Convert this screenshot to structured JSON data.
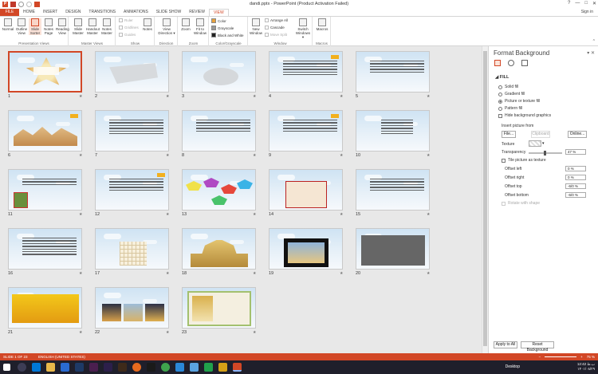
{
  "window": {
    "title": "dandi.pptx - PowerPoint (Product Activation Failed)",
    "controls": [
      "?",
      "—",
      "□",
      "✕"
    ]
  },
  "ribbon_tabs": [
    "FILE",
    "HOME",
    "INSERT",
    "DESIGN",
    "TRANSITIONS",
    "ANIMATIONS",
    "SLIDE SHOW",
    "REVIEW",
    "VIEW"
  ],
  "active_tab": "VIEW",
  "signin": "Sign in",
  "groups": {
    "presentation_views": {
      "label": "Presentation Views",
      "buttons": [
        "Normal",
        "Outline View",
        "Slide Sorter",
        "Notes Page",
        "Reading View"
      ]
    },
    "master_views": {
      "label": "Master Views",
      "buttons": [
        "Slide Master",
        "Handout Master",
        "Notes Master"
      ]
    },
    "show": {
      "label": "Show",
      "items": [
        "Ruler",
        "Gridlines",
        "Guides"
      ],
      "notes_button": "Notes"
    },
    "direction": {
      "label": "Direction",
      "button": "View Direction ▾"
    },
    "zoom": {
      "label": "Zoom",
      "buttons": [
        "Zoom",
        "Fit to Window"
      ]
    },
    "color": {
      "label": "Color/Grayscale",
      "items": [
        "Color",
        "Grayscale",
        "Black and White"
      ]
    },
    "window": {
      "label": "Window",
      "buttons": [
        "New Window",
        "Switch Windows ▾"
      ],
      "items": [
        "Arrange All",
        "Cascade",
        "Move Split"
      ]
    },
    "macros": {
      "label": "Macros",
      "button": "Macros"
    }
  },
  "slides": [
    {
      "n": "1"
    },
    {
      "n": "2"
    },
    {
      "n": "3"
    },
    {
      "n": "4"
    },
    {
      "n": "5"
    },
    {
      "n": "6"
    },
    {
      "n": "7"
    },
    {
      "n": "8"
    },
    {
      "n": "9"
    },
    {
      "n": "10"
    },
    {
      "n": "11"
    },
    {
      "n": "12"
    },
    {
      "n": "13"
    },
    {
      "n": "14"
    },
    {
      "n": "15"
    },
    {
      "n": "16"
    },
    {
      "n": "17"
    },
    {
      "n": "18"
    },
    {
      "n": "19"
    },
    {
      "n": "20"
    },
    {
      "n": "21"
    },
    {
      "n": "22"
    },
    {
      "n": "23"
    }
  ],
  "selected_slide": "1",
  "format_background": {
    "title": "Format Background",
    "section": "FILL",
    "fill_options": [
      "Solid fill",
      "Gradient fill",
      "Picture or texture fill",
      "Pattern fill"
    ],
    "selected_fill": "Picture or texture fill",
    "hide_graphics": "Hide background graphics",
    "insert_from": "Insert picture from",
    "file_button": "File...",
    "clipboard_button": "Clipboard",
    "online_button": "Online...",
    "texture_label": "Texture",
    "transparency_label": "Transparency",
    "transparency_value": "47 %",
    "tile_label": "Tile picture as texture",
    "offsets": [
      {
        "label": "Offset left",
        "value": "0 %"
      },
      {
        "label": "Offset right",
        "value": "0 %"
      },
      {
        "label": "Offset top",
        "value": "-6/0 %"
      },
      {
        "label": "Offset bottom",
        "value": "-6/0 %"
      }
    ],
    "rotate_label": "Rotate with shape",
    "apply_all": "Apply to All",
    "reset": "Reset Background"
  },
  "status": {
    "slide_info": "SLIDE 1 OF 23",
    "language": "ENGLISH (UNITED STATES)",
    "zoom": "75 %"
  },
  "taskbar": {
    "desktop": "Desktop",
    "time": "12:42 ب.ظ",
    "date": "۱۴۰۱/۰۸/۲۹"
  },
  "colors": {
    "accent": "#d24726",
    "taskbar": "#1f1f2b"
  }
}
